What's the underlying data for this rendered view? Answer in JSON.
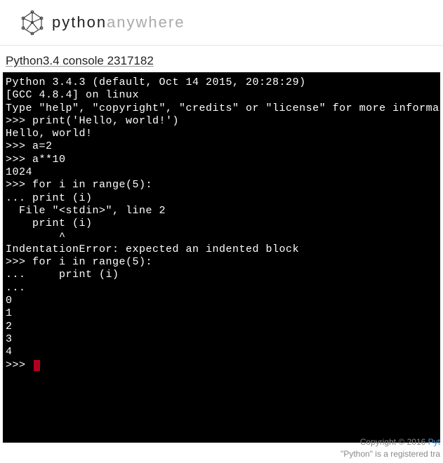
{
  "header": {
    "brand_strong": "python",
    "brand_light": "anywhere"
  },
  "console_title": "Python3.4 console 2317182",
  "terminal_lines": [
    "Python 3.4.3 (default, Oct 14 2015, 20:28:29)",
    "[GCC 4.8.4] on linux",
    "Type \"help\", \"copyright\", \"credits\" or \"license\" for more information.",
    ">>> print('Hello, world!')",
    "Hello, world!",
    ">>> a=2",
    ">>> a**10",
    "1024",
    ">>> for i in range(5):",
    "... print (i)",
    "  File \"<stdin>\", line 2",
    "    print (i)",
    "        ^",
    "IndentationError: expected an indented block",
    ">>> for i in range(5):",
    "...     print (i)",
    "...",
    "0",
    "1",
    "2",
    "3",
    "4",
    ">>> "
  ],
  "footer": {
    "copyright": "Copyright © 2016 ",
    "copyright_link": "Pyt",
    "trademark": "\"Python\" is a registered tra"
  }
}
